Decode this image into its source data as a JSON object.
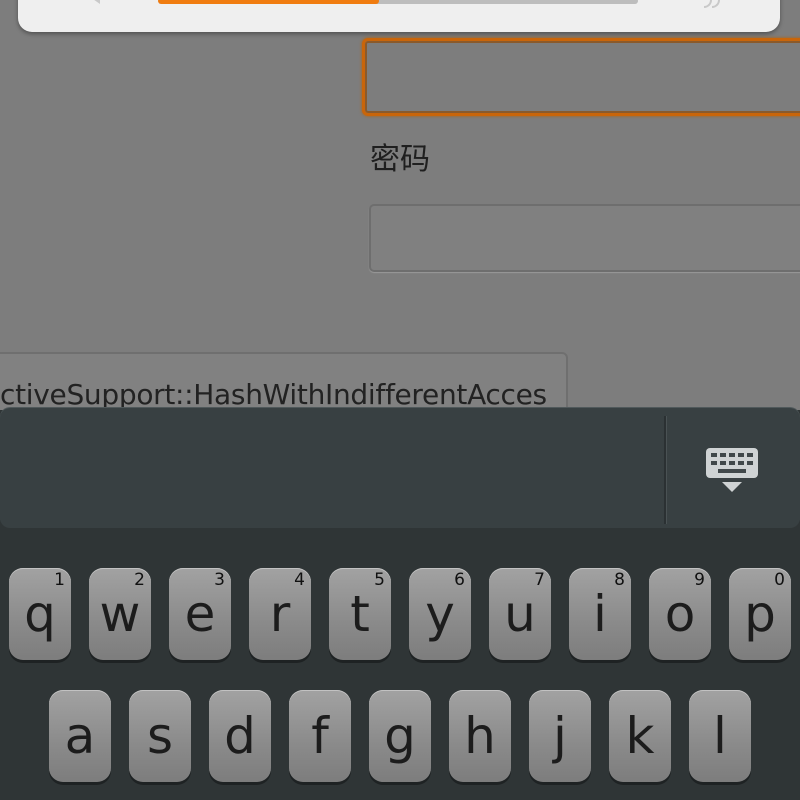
{
  "form": {
    "password_label": "密码",
    "username_value": "",
    "password_value": "",
    "suggestion_text": "ctiveSupport::HashWithIndifferentAcces",
    "progress_percent": 46
  },
  "ime": {
    "toggle_icon": "keyboard-icon",
    "accent_color": "#f07c10"
  },
  "keyboard": {
    "row1": [
      {
        "letter": "q",
        "digit": "1"
      },
      {
        "letter": "w",
        "digit": "2"
      },
      {
        "letter": "e",
        "digit": "3"
      },
      {
        "letter": "r",
        "digit": "4"
      },
      {
        "letter": "t",
        "digit": "5"
      },
      {
        "letter": "y",
        "digit": "6"
      },
      {
        "letter": "u",
        "digit": "7"
      },
      {
        "letter": "i",
        "digit": "8"
      },
      {
        "letter": "o",
        "digit": "9"
      },
      {
        "letter": "p",
        "digit": "0"
      }
    ],
    "row2": [
      {
        "letter": "a"
      },
      {
        "letter": "s"
      },
      {
        "letter": "d"
      },
      {
        "letter": "f"
      },
      {
        "letter": "g"
      },
      {
        "letter": "h"
      },
      {
        "letter": "j"
      },
      {
        "letter": "k"
      },
      {
        "letter": "l"
      }
    ]
  }
}
